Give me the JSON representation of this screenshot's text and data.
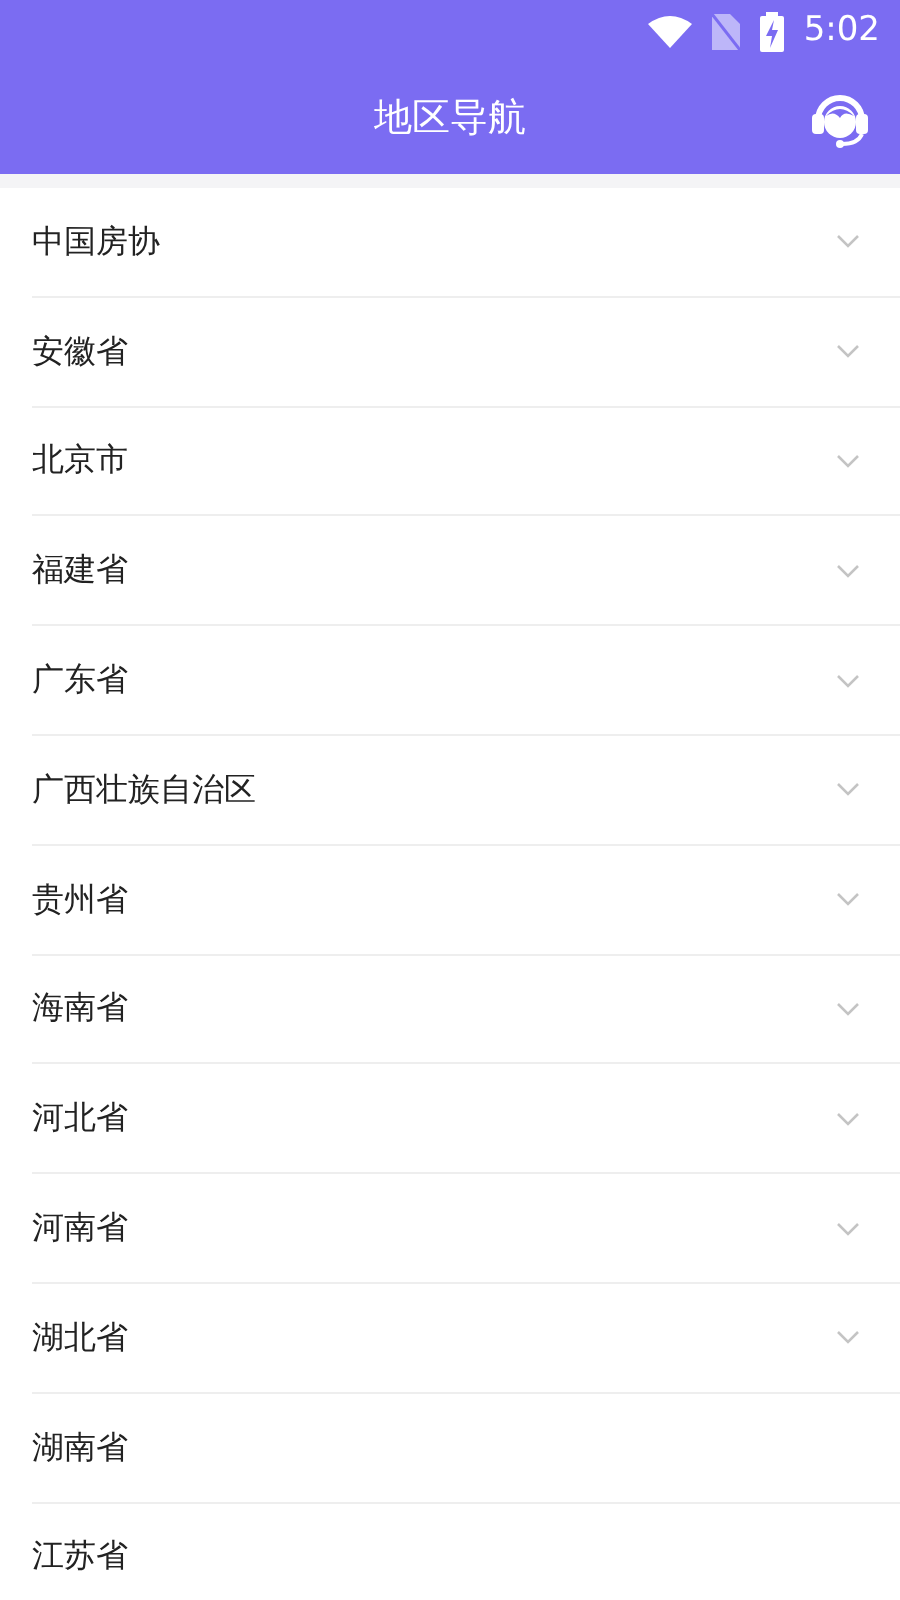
{
  "status_bar": {
    "time": "5:02"
  },
  "header": {
    "title": "地区导航"
  },
  "regions": [
    {
      "label": "中国房协",
      "kind": "expandable"
    },
    {
      "label": "安徽省",
      "kind": "expandable"
    },
    {
      "label": "北京市",
      "kind": "expandable"
    },
    {
      "label": "福建省",
      "kind": "expandable"
    },
    {
      "label": "广东省",
      "kind": "expandable"
    },
    {
      "label": "广西壮族自治区",
      "kind": "expandable"
    },
    {
      "label": "贵州省",
      "kind": "expandable"
    },
    {
      "label": "海南省",
      "kind": "expandable"
    },
    {
      "label": "河北省",
      "kind": "expandable"
    },
    {
      "label": "河南省",
      "kind": "expandable"
    },
    {
      "label": "湖北省",
      "kind": "expandable"
    },
    {
      "label": "湖南省",
      "kind": "plain"
    },
    {
      "label": "江苏省",
      "kind": "plain"
    }
  ]
}
